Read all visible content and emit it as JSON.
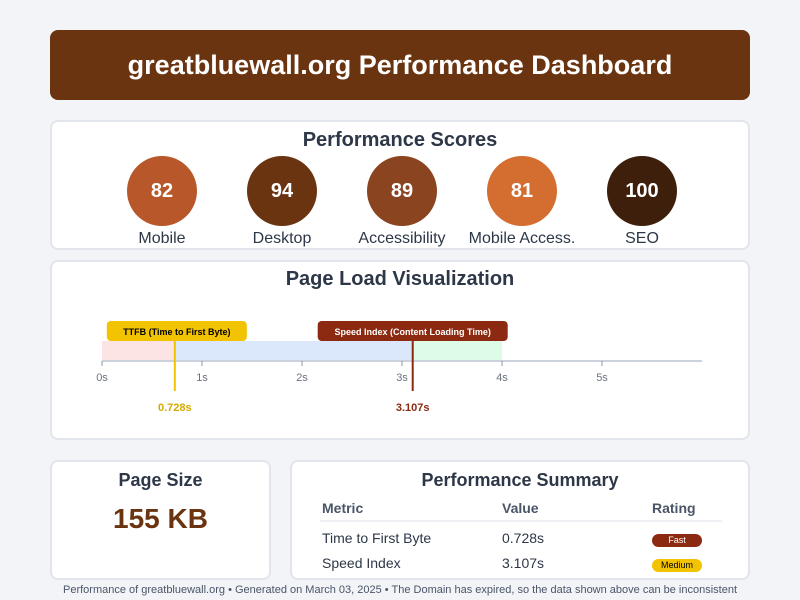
{
  "header": {
    "title": "greatbluewall.org Performance Dashboard"
  },
  "scores": {
    "title": "Performance Scores",
    "items": [
      {
        "value": "82",
        "label": "Mobile",
        "color": "#b8582a"
      },
      {
        "value": "94",
        "label": "Desktop",
        "color": "#6b3410"
      },
      {
        "value": "89",
        "label": "Accessibility",
        "color": "#8a4420"
      },
      {
        "value": "81",
        "label": "Mobile Access.",
        "color": "#d46e30"
      },
      {
        "value": "100",
        "label": "SEO",
        "color": "#3d1f0c"
      }
    ]
  },
  "timeline": {
    "title": "Page Load Visualization",
    "axis_ticks": [
      "0s",
      "1s",
      "2s",
      "3s",
      "4s",
      "5s"
    ],
    "axis_max_seconds": 5,
    "segments": [
      {
        "start": 0,
        "end": 0.728,
        "color": "#fde4e4"
      },
      {
        "start": 0.728,
        "end": 3.107,
        "color": "#dbe8fb"
      },
      {
        "start": 3.107,
        "end": 4.0,
        "color": "#dcfce7"
      }
    ],
    "markers": [
      {
        "label": "TTFB (Time to First Byte)",
        "value_seconds": 0.728,
        "value_text": "0.728s",
        "color": "#f2c300",
        "text_color": "#000000"
      },
      {
        "label": "Speed Index (Content Loading Time)",
        "value_seconds": 3.107,
        "value_text": "3.107s",
        "color": "#8b2a10",
        "text_color": "#ffffff"
      }
    ]
  },
  "page_size": {
    "title": "Page Size",
    "value": "155 KB"
  },
  "summary": {
    "title": "Performance Summary",
    "headers": [
      "Metric",
      "Value",
      "Rating"
    ],
    "rows": [
      {
        "metric": "Time to First Byte",
        "value": "0.728s",
        "rating": "Fast",
        "rating_bg": "#8b2a10",
        "rating_fg": "#ffffff"
      },
      {
        "metric": "Speed Index",
        "value": "3.107s",
        "rating": "Medium",
        "rating_bg": "#f2c300",
        "rating_fg": "#000000"
      }
    ]
  },
  "footer": {
    "text": "Performance of greatbluewall.org • Generated on March 03, 2025 • The Domain has expired, so the data shown above can be inconsistent"
  }
}
